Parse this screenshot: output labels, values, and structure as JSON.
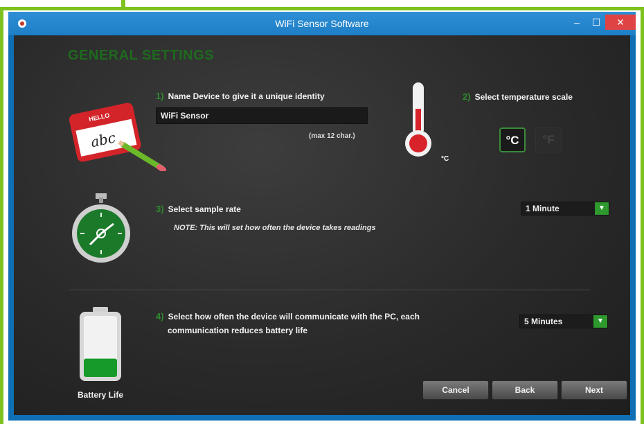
{
  "window": {
    "title": "WiFi Sensor Software",
    "minimize": "–",
    "maximize": "☐",
    "close": "✕"
  },
  "section_title": "GENERAL SETTINGS",
  "step1": {
    "number": "1)",
    "label": "Name Device to give it a unique identity",
    "input_value": "WiFi Sensor",
    "hint": "(max 12 char.)"
  },
  "step2": {
    "number": "2)",
    "label": "Select temperature scale",
    "thermometer_unit": "°C",
    "options": [
      "°C",
      "°F"
    ],
    "selected": "°C"
  },
  "step3": {
    "number": "3)",
    "label": "Select sample rate",
    "note": "NOTE: This will set how often the device takes readings",
    "selected": "1 Minute"
  },
  "step4": {
    "number": "4)",
    "label_line1": "Select how often the device will communicate with the PC, each",
    "label_line2": "communication reduces battery life",
    "selected": "5 Minutes"
  },
  "battery": {
    "label": "Battery Life",
    "level": 0.3
  },
  "buttons": {
    "cancel": "Cancel",
    "back": "Back",
    "next": "Next"
  },
  "colors": {
    "accent_green": "#2e9a2e",
    "frame_green": "#7dc21e",
    "titlebar_blue": "#1e7ec6",
    "close_red": "#e04343"
  },
  "icons": [
    "name-tag-icon",
    "pencil-icon",
    "thermometer-icon",
    "stopwatch-icon",
    "battery-icon",
    "dropdown-arrow-icon"
  ]
}
